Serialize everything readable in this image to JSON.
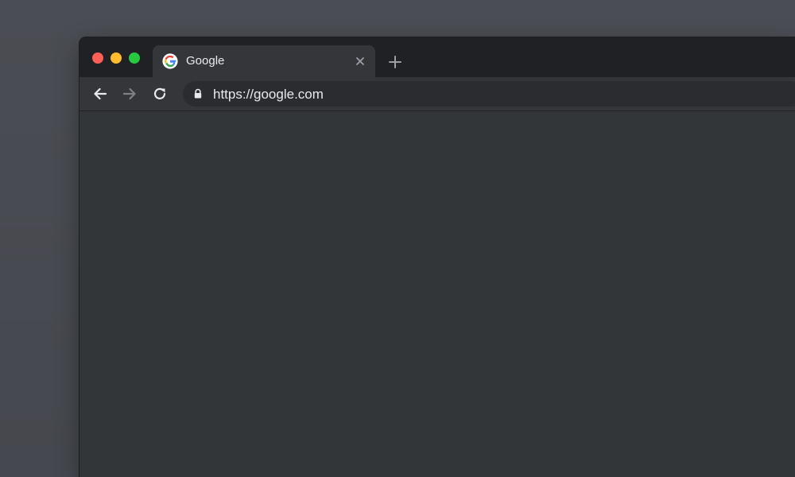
{
  "window": {
    "traffic_lights": {
      "close_color": "#fe5f57",
      "minimize_color": "#febc2e",
      "maximize_color": "#28c840"
    }
  },
  "tabs": [
    {
      "title": "Google",
      "favicon": "google-g-icon",
      "active": true,
      "close_icon": "close-icon"
    }
  ],
  "new_tab_icon": "plus-icon",
  "toolbar": {
    "back_icon": "arrow-left-icon",
    "forward_icon": "arrow-right-icon",
    "forward_enabled": false,
    "reload_icon": "reload-icon",
    "omnibox": {
      "secure_icon": "lock-icon",
      "url": "https://google.com"
    }
  },
  "colors": {
    "tabstrip_bg": "#202124",
    "toolbar_bg": "#35363a",
    "content_bg": "#323639",
    "text": "#e8eaed"
  }
}
